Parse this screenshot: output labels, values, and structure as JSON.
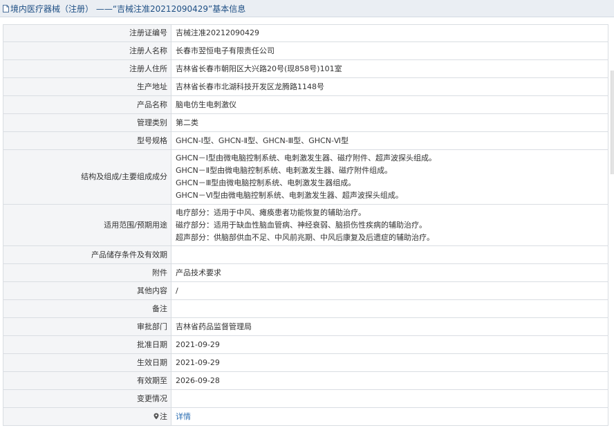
{
  "page": {
    "title": "境内医疗器械（注册） ——“吉械注准20212090429”基本信息",
    "icons": {
      "title": "document-icon",
      "note": "pin-icon"
    },
    "colors": {
      "title_text": "#1e4f84",
      "label_background": "#f4f5f7",
      "link": "#2a6db2"
    }
  },
  "rows": [
    {
      "key": "reg_no",
      "label": "注册证编号",
      "value": "吉械注准20212090429"
    },
    {
      "key": "registrant_name",
      "label": "注册人名称",
      "value": "长春市翌恒电子有限责任公司"
    },
    {
      "key": "registrant_address",
      "label": "注册人住所",
      "value": "吉林省长春市朝阳区大兴路20号(现858号)101室"
    },
    {
      "key": "production_address",
      "label": "生产地址",
      "value": "吉林省长春市北湖科技开发区龙腾路1148号"
    },
    {
      "key": "product_name",
      "label": "产品名称",
      "value": "脑电仿生电刺激仪"
    },
    {
      "key": "management_class",
      "label": "管理类别",
      "value": "第二类"
    },
    {
      "key": "model_spec",
      "label": "型号规格",
      "value": "GHCN-Ⅰ型、GHCN-Ⅱ型、GHCN-Ⅲ型、GHCN-Ⅵ型"
    },
    {
      "key": "structure",
      "label": "结构及组成/主要组成成分",
      "lines": [
        "GHCN－Ⅰ型由微电脑控制系统、电刺激发生器、磁疗附件、超声波探头组成。",
        "GHCN－Ⅱ型由微电脑控制系统、电刺激发生器、磁疗附件组成。",
        "GHCN－Ⅲ型由微电脑控制系统、电刺激发生器组成。",
        "GHCN－Ⅵ型由微电脑控制系统、电刺激发生器、超声波探头组成。"
      ]
    },
    {
      "key": "scope",
      "label": "适用范围/预期用途",
      "lines": [
        "电疗部分：适用于中风、瘫痪患者功能恢复的辅助治疗。",
        "磁疗部分：适用于缺血性脑血管病、神经衰弱、脑损伤性疾病的辅助治疗。",
        "超声部分：供脑部供血不足、中风前兆期、中风后康复及后遗症的辅助治疗。"
      ]
    },
    {
      "key": "storage",
      "label": "产品储存条件及有效期",
      "value": ""
    },
    {
      "key": "attachment",
      "label": "附件",
      "value": "产品技术要求"
    },
    {
      "key": "other",
      "label": "其他内容",
      "value": "/"
    },
    {
      "key": "remark",
      "label": "备注",
      "value": ""
    },
    {
      "key": "approval_dept",
      "label": "审批部门",
      "value": "吉林省药品监督管理局"
    },
    {
      "key": "approval_date",
      "label": "批准日期",
      "value": "2021-09-29"
    },
    {
      "key": "effective_date",
      "label": "生效日期",
      "value": "2021-09-29"
    },
    {
      "key": "expiry_date",
      "label": "有效期至",
      "value": "2026-09-28"
    },
    {
      "key": "changes",
      "label": "变更情况",
      "value": ""
    },
    {
      "key": "note",
      "label": "注",
      "value": "详情"
    }
  ]
}
